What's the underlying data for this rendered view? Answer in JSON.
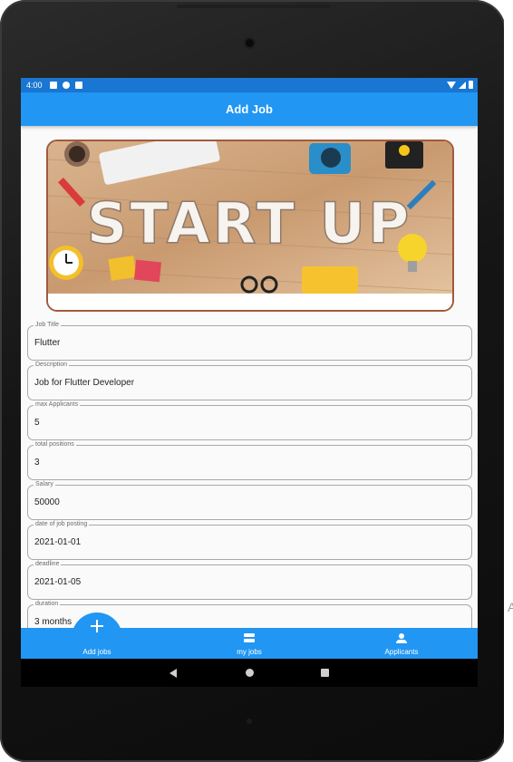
{
  "status_bar": {
    "time": "4:00"
  },
  "app_bar": {
    "title": "Add Job"
  },
  "banner": {
    "text": "START UP"
  },
  "form": {
    "fields": [
      {
        "label": "Job Title",
        "value": "Flutter"
      },
      {
        "label": "Description",
        "value": "Job for Flutter Developer"
      },
      {
        "label": "max Applicants",
        "value": "5"
      },
      {
        "label": "total positions",
        "value": "3"
      },
      {
        "label": "Salary",
        "value": "50000"
      },
      {
        "label": "date of job posting",
        "value": "2021-01-01"
      },
      {
        "label": "deadline",
        "value": "2021-01-05"
      },
      {
        "label": "duration",
        "value": "3 months"
      }
    ]
  },
  "bottom_nav": {
    "items": [
      {
        "label": "Add jobs",
        "icon": "plus-icon"
      },
      {
        "label": "my jobs",
        "icon": "jobs-icon"
      },
      {
        "label": "Applicants",
        "icon": "person-icon"
      }
    ]
  },
  "colors": {
    "primary": "#2196f3",
    "status_bar": "#1976d2",
    "banner_border": "#a15a3c"
  }
}
